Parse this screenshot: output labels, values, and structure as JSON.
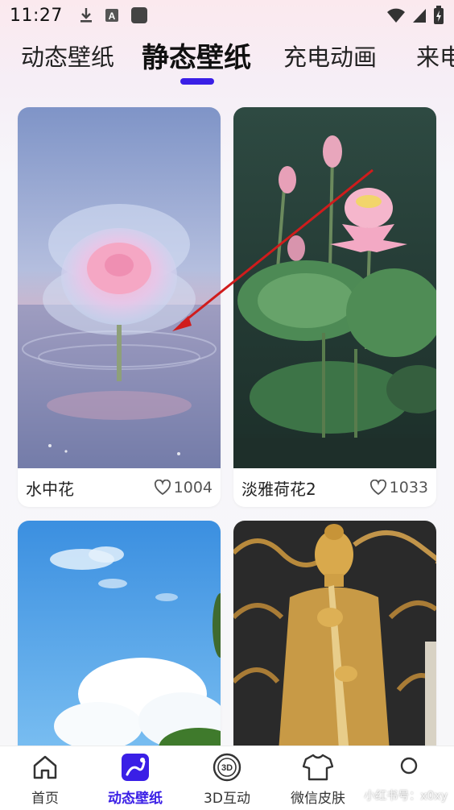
{
  "status_bar": {
    "time": "11:27",
    "left_icons": [
      "download-icon",
      "a-badge-icon",
      "app-square-icon"
    ],
    "right_icons": [
      "wifi-icon",
      "signal-icon",
      "battery-icon"
    ]
  },
  "tabs": [
    {
      "label": "动态壁纸",
      "active": false
    },
    {
      "label": "静态壁纸",
      "active": true
    },
    {
      "label": "充电动画",
      "active": false
    },
    {
      "label": "来电",
      "active": false
    }
  ],
  "cards": [
    {
      "title": "水中花",
      "likes": "1004",
      "image": "glass-flower-on-water"
    },
    {
      "title": "淡雅荷花2",
      "likes": "1033",
      "image": "pink-lotus-leaves"
    },
    {
      "title": "",
      "likes": "",
      "image": "blue-sky-clouds"
    },
    {
      "title": "",
      "likes": "",
      "image": "golden-buddha-statue"
    }
  ],
  "bottom_nav": [
    {
      "label": "首页",
      "icon": "home-icon",
      "active": false
    },
    {
      "label": "动态壁纸",
      "icon": "wallpaper-icon",
      "active": true
    },
    {
      "label": "3D互动",
      "icon": "3d-icon",
      "active": false
    },
    {
      "label": "微信皮肤",
      "icon": "shirt-icon",
      "active": false
    },
    {
      "label": "",
      "icon": "circle-icon",
      "active": false
    }
  ],
  "watermark": "小红书号：x0xy",
  "colors": {
    "accent": "#3a1fe6",
    "annotation_arrow": "#d01c1c"
  }
}
